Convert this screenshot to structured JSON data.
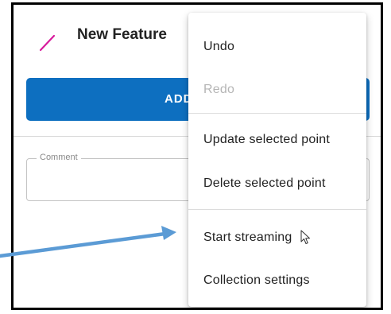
{
  "feature": {
    "title": "New Feature",
    "icon": "pencil-icon",
    "icon_color": "#d81b9c"
  },
  "add_button": {
    "label": "ADD",
    "color": "#0d6fc0"
  },
  "comment": {
    "label": "Comment",
    "value": ""
  },
  "menu": {
    "items": [
      {
        "label": "Undo",
        "enabled": true
      },
      {
        "label": "Redo",
        "enabled": false
      },
      {
        "label": "Update selected point",
        "enabled": true
      },
      {
        "label": "Delete selected point",
        "enabled": true
      },
      {
        "label": "Start streaming",
        "enabled": true
      },
      {
        "label": "Collection settings",
        "enabled": true
      }
    ]
  },
  "annotation": {
    "type": "arrow",
    "color": "#5b9bd5",
    "points_to": "Start streaming"
  }
}
